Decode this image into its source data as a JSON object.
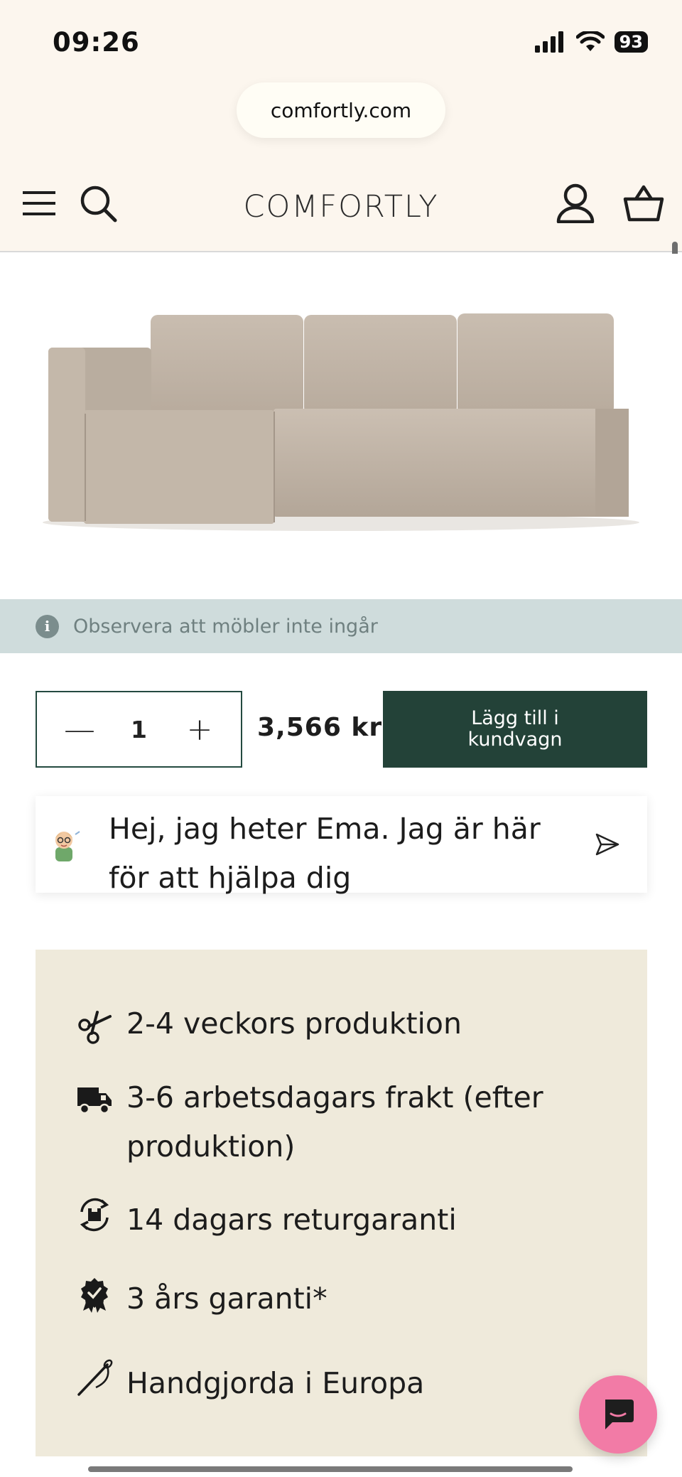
{
  "status_bar": {
    "time": "09:26",
    "battery": "93"
  },
  "browser": {
    "url": "comfortly.com"
  },
  "header": {
    "logo": "COMFORTLY"
  },
  "notice": {
    "text": "Observera att möbler inte ingår"
  },
  "purchase": {
    "quantity": "1",
    "minus": "—",
    "plus": "+",
    "price": "3,566 kr",
    "add_to_cart": "Lägg till i kundvagn"
  },
  "chat": {
    "message": "Hej, jag heter Ema. Jag är här för att hjälpa dig"
  },
  "benefits": [
    {
      "icon": "scissors-icon",
      "text": "2-4 veckors produktion"
    },
    {
      "icon": "truck-icon",
      "text": "3-6 arbetsdagars frakt (efter produktion)"
    },
    {
      "icon": "return-box-icon",
      "text": "14 dagars returgaranti"
    },
    {
      "icon": "badge-check-icon",
      "text": "3 års garanti*"
    },
    {
      "icon": "needle-icon",
      "text": "Handgjorda i Europa"
    }
  ],
  "colors": {
    "header_bg": "#fcf6ee",
    "notice_bg": "#cfdcdc",
    "button_bg": "#234238",
    "benefits_bg": "#efeadb",
    "chat_fab": "#f27ba6"
  }
}
